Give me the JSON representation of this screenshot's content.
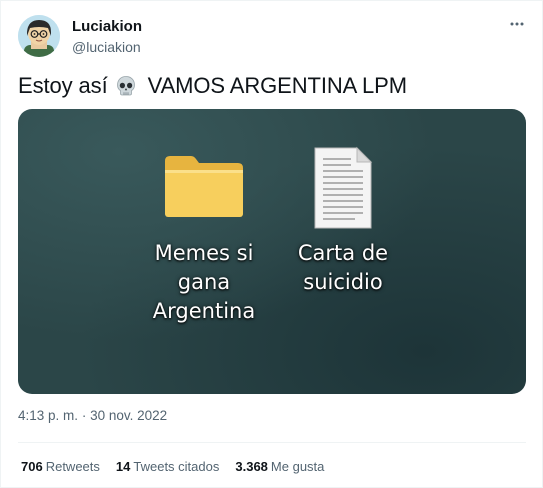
{
  "author": {
    "display_name": "Luciakion",
    "handle": "@luciakion",
    "avatar_icon": "cartoon-avatar"
  },
  "more_icon": "more-horizontal-icon",
  "tweet": {
    "text_before": "Estoy así",
    "emoji": "skull-emoji",
    "text_after": "VAMOS ARGENTINA LPM"
  },
  "media": {
    "desktop_icons": [
      {
        "label": "Memes si\ngana\nArgentina",
        "icon": "folder-icon"
      },
      {
        "label": "Carta de\nsuicidio",
        "icon": "text-document-icon"
      }
    ]
  },
  "meta": {
    "time": "4:13 p. m.",
    "separator": "·",
    "date": "30 nov. 2022"
  },
  "stats": {
    "retweets_count": "706",
    "retweets_label": "Retweets",
    "quotes_count": "14",
    "quotes_label": "Tweets citados",
    "likes_count": "3.368",
    "likes_label": "Me gusta"
  },
  "colors": {
    "text": "#0f1419",
    "secondary": "#536471",
    "border": "#eff3f4",
    "desktop_bg": "#2b4648",
    "folder": "#f7cf5d"
  }
}
